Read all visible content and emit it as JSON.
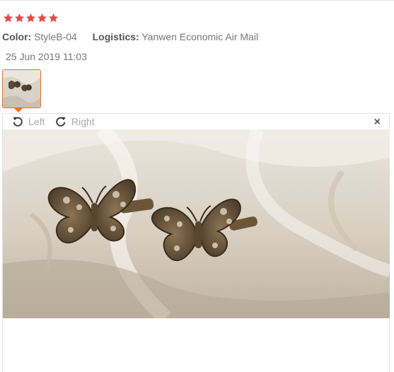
{
  "review": {
    "rating": 5,
    "color_label": "Color:",
    "color_value": "StyleB-04",
    "logistics_label": "Logistics:",
    "logistics_value": "Yanwen Economic Air Mail",
    "date": "25 Jun 2019 11:03"
  },
  "viewer": {
    "rotate_left_label": "Left",
    "rotate_right_label": "Right",
    "close_glyph": "×"
  },
  "colors": {
    "star": "#e8484b",
    "accent": "#e5742a"
  },
  "icons": {
    "rotate_left": "rotate-left-icon",
    "rotate_right": "rotate-right-icon",
    "close": "close-icon"
  }
}
